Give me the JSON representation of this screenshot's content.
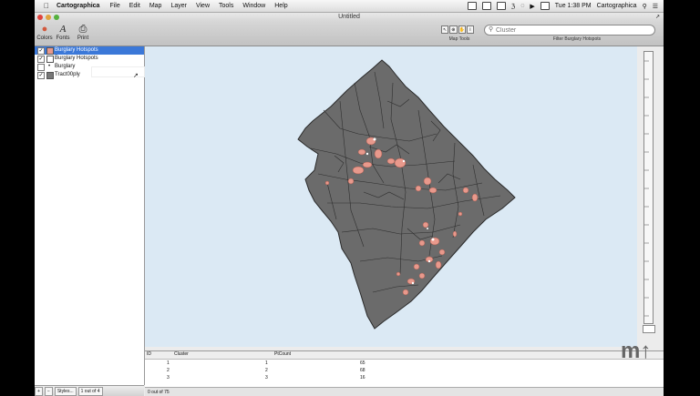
{
  "menubar": {
    "app_name": "Cartographica",
    "items": [
      "File",
      "Edit",
      "Map",
      "Layer",
      "View",
      "Tools",
      "Window",
      "Help"
    ],
    "clock": "Tue 1:38 PM",
    "user": "Cartographica"
  },
  "window": {
    "title": "Untitled"
  },
  "toolbar": {
    "colors_label": "Colors",
    "fonts_label": "Fonts",
    "print_label": "Print",
    "map_tools_label": "Map Tools",
    "search_placeholder": "Cluster",
    "filter_label": "Filter Burglary Hotspots"
  },
  "layers": [
    {
      "name": "Burglary Hotspots",
      "checked": true,
      "selected": true
    },
    {
      "name": "Burglary Hotspots",
      "checked": true,
      "selected": false
    },
    {
      "name": "Burglary",
      "checked": false,
      "selected": false
    },
    {
      "name": "Tract00ply",
      "checked": true,
      "selected": false
    }
  ],
  "sidebar_footer": {
    "add": "+",
    "remove": "−",
    "styles": "Styles...",
    "count": "1 out of 4"
  },
  "table": {
    "columns": [
      "ID",
      "Cluster",
      "PtCount"
    ],
    "rows": [
      [
        "1",
        "1",
        "65"
      ],
      [
        "2",
        "2",
        "68"
      ],
      [
        "3",
        "3",
        "16"
      ]
    ],
    "footer": "0 out of 75"
  },
  "colors": {
    "map_land": "#6b6b6b",
    "map_water": "#dbe9f4",
    "hotspot": "#e8998c",
    "selection": "#3b78d8"
  }
}
